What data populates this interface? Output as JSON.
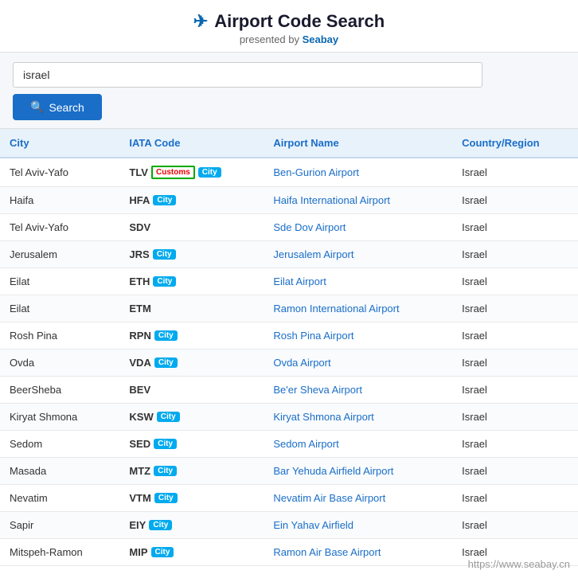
{
  "header": {
    "icon": "✈",
    "title": "Airport Code Search",
    "subtitle": "presented by ",
    "brand": "Seabay"
  },
  "search": {
    "placeholder": "",
    "value": "israel",
    "button_label": "Search",
    "button_icon": "🔍"
  },
  "table": {
    "columns": [
      "City",
      "IATA Code",
      "Airport Name",
      "Country/Region"
    ],
    "rows": [
      {
        "city": "Tel Aviv-Yafo",
        "iata": "TLV",
        "badges": [
          "customs",
          "city"
        ],
        "airport": "Ben-Gurion Airport",
        "country": "Israel"
      },
      {
        "city": "Haifa",
        "iata": "HFA",
        "badges": [
          "city"
        ],
        "airport": "Haifa International Airport",
        "country": "Israel"
      },
      {
        "city": "Tel Aviv-Yafo",
        "iata": "SDV",
        "badges": [],
        "airport": "Sde Dov Airport",
        "country": "Israel"
      },
      {
        "city": "Jerusalem",
        "iata": "JRS",
        "badges": [
          "city"
        ],
        "airport": "Jerusalem Airport",
        "country": "Israel"
      },
      {
        "city": "Eilat",
        "iata": "ETH",
        "badges": [
          "city"
        ],
        "airport": "Eilat Airport",
        "country": "Israel"
      },
      {
        "city": "Eilat",
        "iata": "ETM",
        "badges": [],
        "airport": "Ramon International Airport",
        "country": "Israel"
      },
      {
        "city": "Rosh Pina",
        "iata": "RPN",
        "badges": [
          "city"
        ],
        "airport": "Rosh Pina Airport",
        "country": "Israel"
      },
      {
        "city": "Ovda",
        "iata": "VDA",
        "badges": [
          "city"
        ],
        "airport": "Ovda Airport",
        "country": "Israel"
      },
      {
        "city": "BeerSheba",
        "iata": "BEV",
        "badges": [],
        "airport": "Be'er Sheva Airport",
        "country": "Israel"
      },
      {
        "city": "Kiryat Shmona",
        "iata": "KSW",
        "badges": [
          "city"
        ],
        "airport": "Kiryat Shmona Airport",
        "country": "Israel"
      },
      {
        "city": "Sedom",
        "iata": "SED",
        "badges": [
          "city"
        ],
        "airport": "Sedom Airport",
        "country": "Israel"
      },
      {
        "city": "Masada",
        "iata": "MTZ",
        "badges": [
          "city"
        ],
        "airport": "Bar Yehuda Airfield Airport",
        "country": "Israel"
      },
      {
        "city": "Nevatim",
        "iata": "VTM",
        "badges": [
          "city"
        ],
        "airport": "Nevatim Air Base Airport",
        "country": "Israel"
      },
      {
        "city": "Sapir",
        "iata": "EIY",
        "badges": [
          "city"
        ],
        "airport": "Ein Yahav Airfield",
        "country": "Israel"
      },
      {
        "city": "Mitspeh-Ramon",
        "iata": "MIP",
        "badges": [
          "city"
        ],
        "airport": "Ramon Air Base Airport",
        "country": "Israel"
      }
    ]
  },
  "watermark": "https://www.seabay.cn"
}
